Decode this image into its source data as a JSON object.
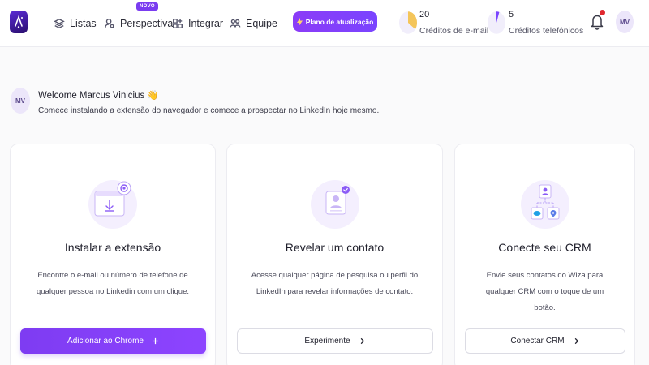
{
  "nav": {
    "listas": "Listas",
    "perspectiva": "Perspectiva",
    "novo_badge": "NOVO",
    "integrar": "Integrar",
    "equipe": "Equipe"
  },
  "upgrade": {
    "label": "Plano de atualização",
    "icon": "bolt-icon"
  },
  "credits": {
    "email": {
      "count": "20",
      "label": "Créditos de e-mail",
      "fill": 0.35
    },
    "phone": {
      "count": "5",
      "label": "Créditos telefônicos",
      "fill": 0.05
    }
  },
  "user": {
    "initials": "MV"
  },
  "welcome": {
    "title": "Welcome Marcus Vinicius 👋",
    "subtitle": "Comece instalando a extensão do navegador e comece a prospectar no LinkedIn hoje mesmo."
  },
  "cards": [
    {
      "title": "Instalar a extensão",
      "description": "Encontre o e-mail ou número de telefone de qualquer pessoa no Linkedin com um clique.",
      "button": "Adicionar ao Chrome",
      "button_icon": "plus-icon"
    },
    {
      "title": "Revelar um contato",
      "description": "Acesse qualquer página de pesquisa ou perfil do LinkedIn para revelar informações de contato.",
      "button": "Experimente",
      "button_icon": "chevron-right-icon"
    },
    {
      "title": "Conecte seu CRM",
      "description": "Envie seus contatos do Wiza para qualquer CRM com o toque de um botão.",
      "button": "Conectar CRM",
      "button_icon": "chevron-right-icon"
    }
  ],
  "colors": {
    "accent": "#7e3cf2",
    "notification": "#e0282e",
    "email_ring": "#f4c55a",
    "phone_ring": "#7a44ff"
  }
}
